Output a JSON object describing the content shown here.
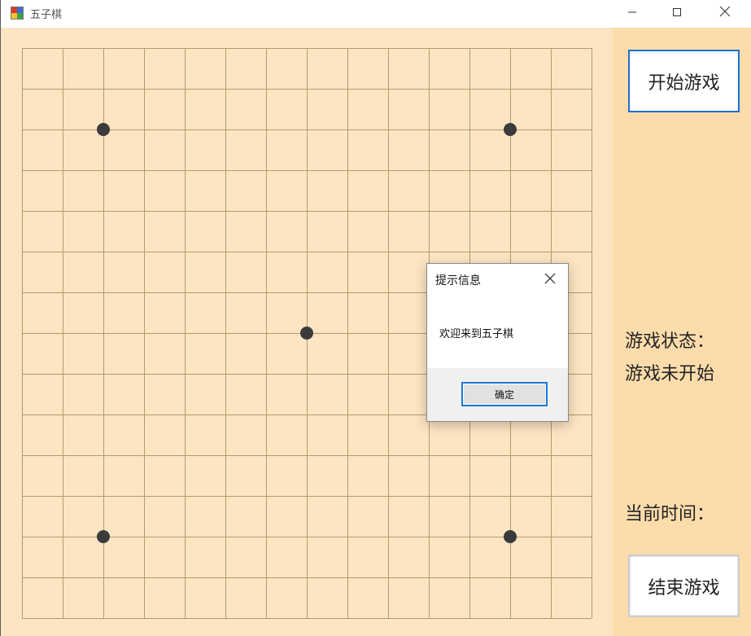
{
  "window": {
    "title": "五子棋",
    "app_icon": "gomoku-app-icon",
    "controls": [
      "minimize-icon",
      "maximize-icon",
      "close-icon"
    ]
  },
  "board": {
    "grid_lines": 15,
    "star_points": [
      [
        2,
        2
      ],
      [
        12,
        2
      ],
      [
        7,
        7
      ],
      [
        2,
        12
      ],
      [
        12,
        12
      ]
    ],
    "colors": {
      "background": "#fde5c3",
      "line": "#b49a6a",
      "star": "#3b3b3b"
    }
  },
  "sidebar": {
    "start_label": "开始游戏",
    "status_label": "游戏状态：",
    "status_value": "游戏未开始",
    "time_label": "当前时间：",
    "end_label": "结束游戏",
    "background": "#fddcac"
  },
  "dialog": {
    "title": "提示信息",
    "message": "欢迎来到五子棋",
    "ok_label": "确定"
  }
}
